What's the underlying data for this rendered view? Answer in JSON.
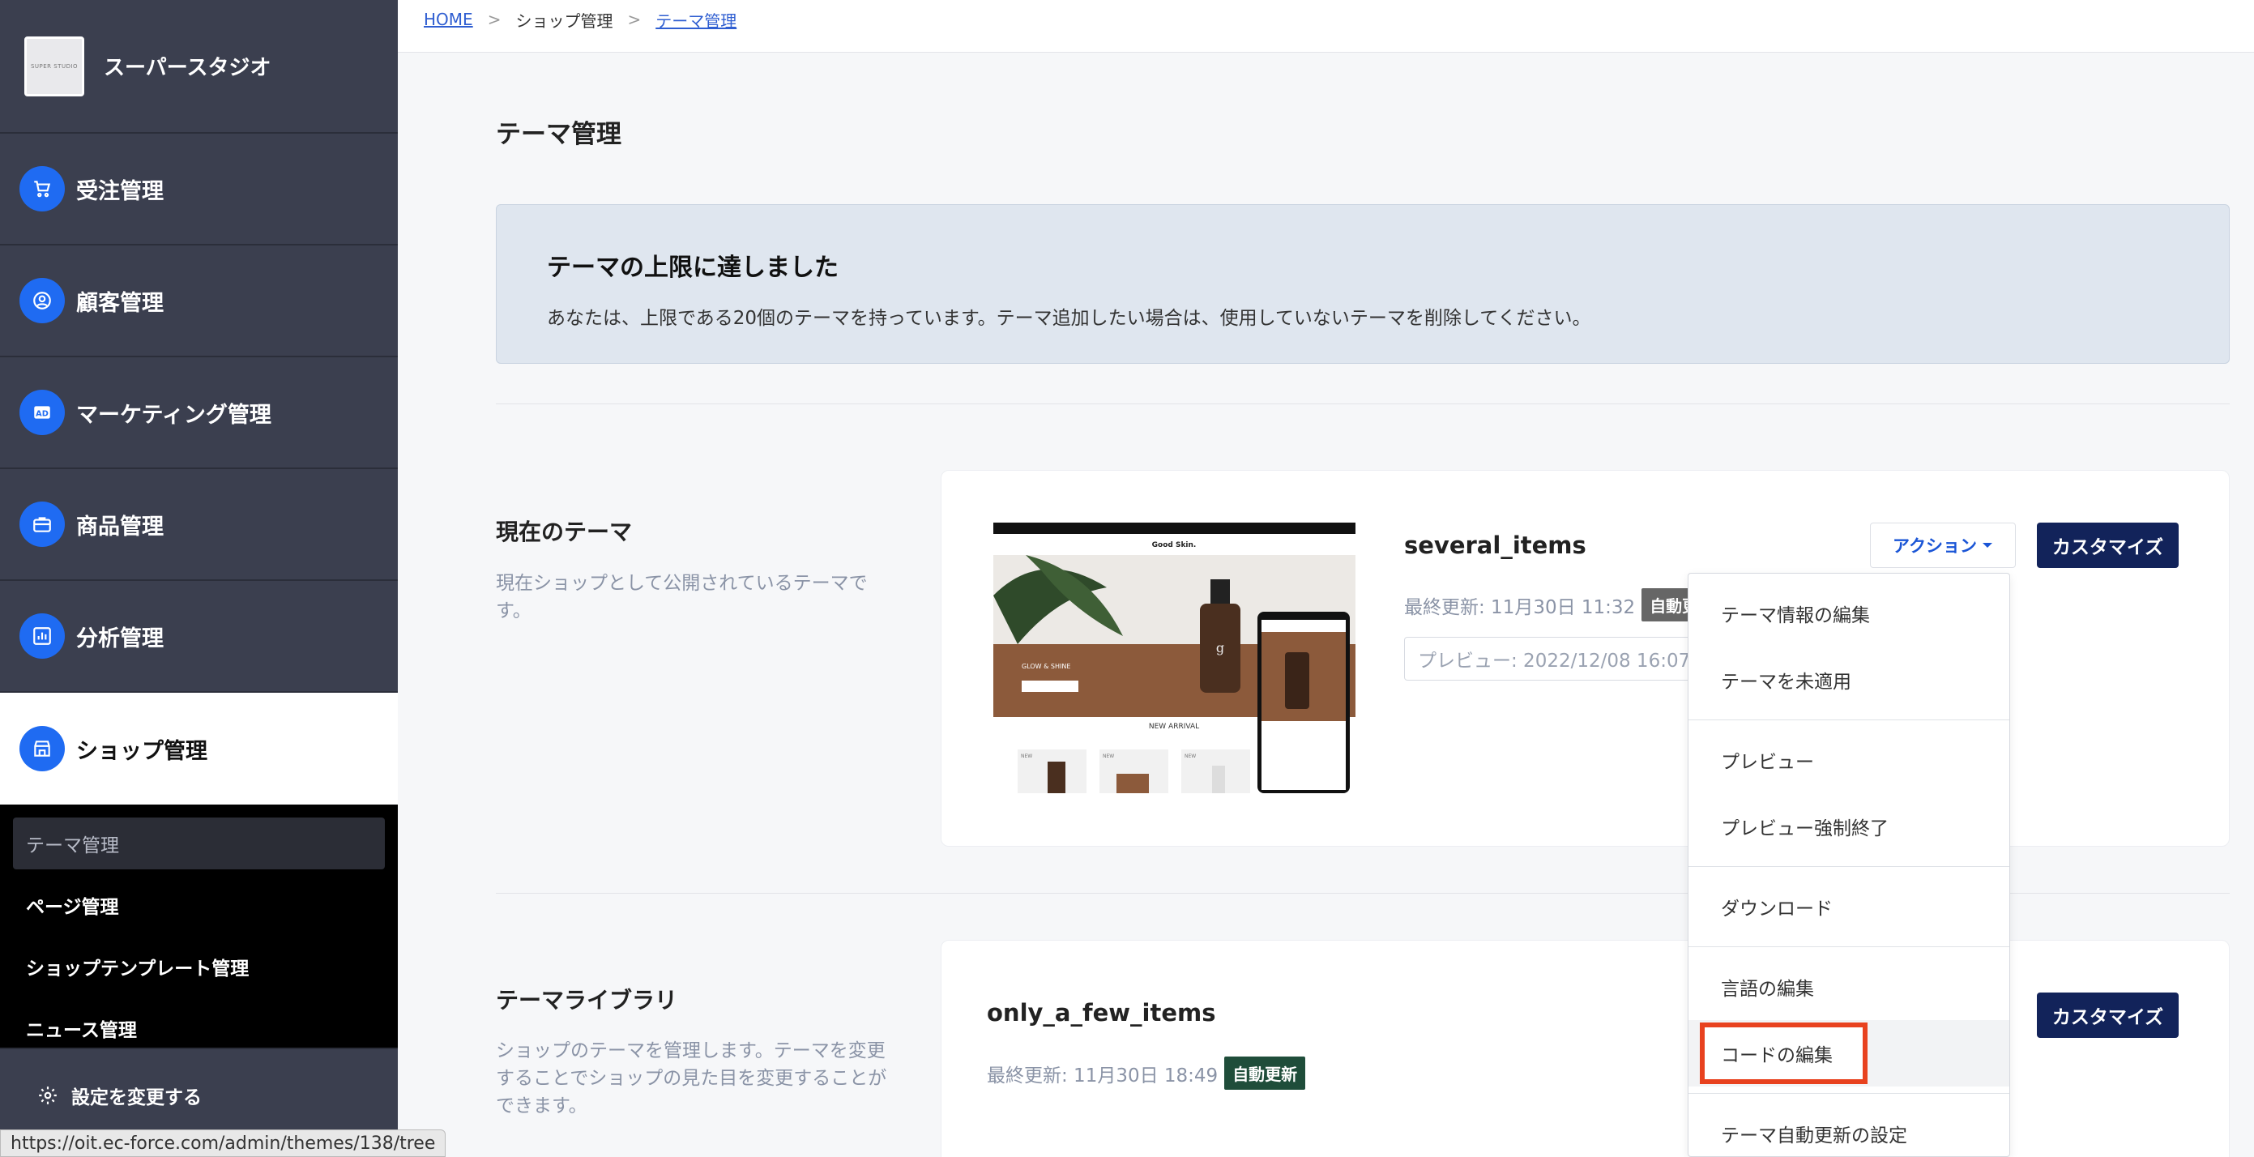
{
  "sidebar": {
    "brand_logo_text": "SUPER STUDIO",
    "brand_name": "スーパースタジオ",
    "nav": [
      {
        "label": "受注管理",
        "icon": "cart-icon"
      },
      {
        "label": "顧客管理",
        "icon": "user-circle-icon"
      },
      {
        "label": "マーケティング管理",
        "icon": "ad-icon"
      },
      {
        "label": "商品管理",
        "icon": "briefcase-icon"
      },
      {
        "label": "分析管理",
        "icon": "chart-icon"
      },
      {
        "label": "ショップ管理",
        "icon": "store-icon"
      }
    ],
    "sub": [
      "テーマ管理",
      "ページ管理",
      "ショップテンプレート管理",
      "ニュース管理"
    ],
    "settings_label": "設定を変更する"
  },
  "status_url": "https://oit.ec-force.com/admin/themes/138/tree",
  "breadcrumb": {
    "home": "HOME",
    "sep": ">",
    "shop": "ショップ管理",
    "current": "テーマ管理"
  },
  "page_title": "テーマ管理",
  "notice": {
    "title": "テーマの上限に達しました",
    "body": "あなたは、上限である20個のテーマを持っています。テーマ追加したい場合は、使用していないテーマを削除してください。"
  },
  "current_theme": {
    "section_title": "現在のテーマ",
    "section_desc": "現在ショップとして公開されているテーマです。",
    "name": "several_items",
    "updated": "最終更新: 11月30日 11:32",
    "badge": "自動更新",
    "preview": "プレビュー: 2022/12/08 16:07",
    "action_label": "アクション",
    "customize_label": "カスタマイズ"
  },
  "thumbnail": {
    "brand": "Good Skin.",
    "hero_text": "GLOW & SHINE",
    "section": "NEW ARRIVAL",
    "tag": "NEW",
    "bottle_mark": "g"
  },
  "library": {
    "section_title": "テーマライブラリ",
    "section_desc": "ショップのテーマを管理します。テーマを変更することでショップの見た目を変更することができます。",
    "name": "only_a_few_items",
    "updated": "最終更新: 11月30日 18:49",
    "badge": "自動更新",
    "customize_label": "カスタマイズ"
  },
  "dropdown": {
    "items": [
      "テーマ情報の編集",
      "テーマを未適用",
      "プレビュー",
      "プレビュー強制終了",
      "ダウンロード",
      "言語の編集",
      "コードの編集",
      "テーマ自動更新の設定"
    ]
  },
  "colors": {
    "accent": "#1f6bf2",
    "navy": "#12235a",
    "badge": "#1f4d3a",
    "highlight": "#e8421f",
    "sidebar": "#3b3f4f"
  }
}
